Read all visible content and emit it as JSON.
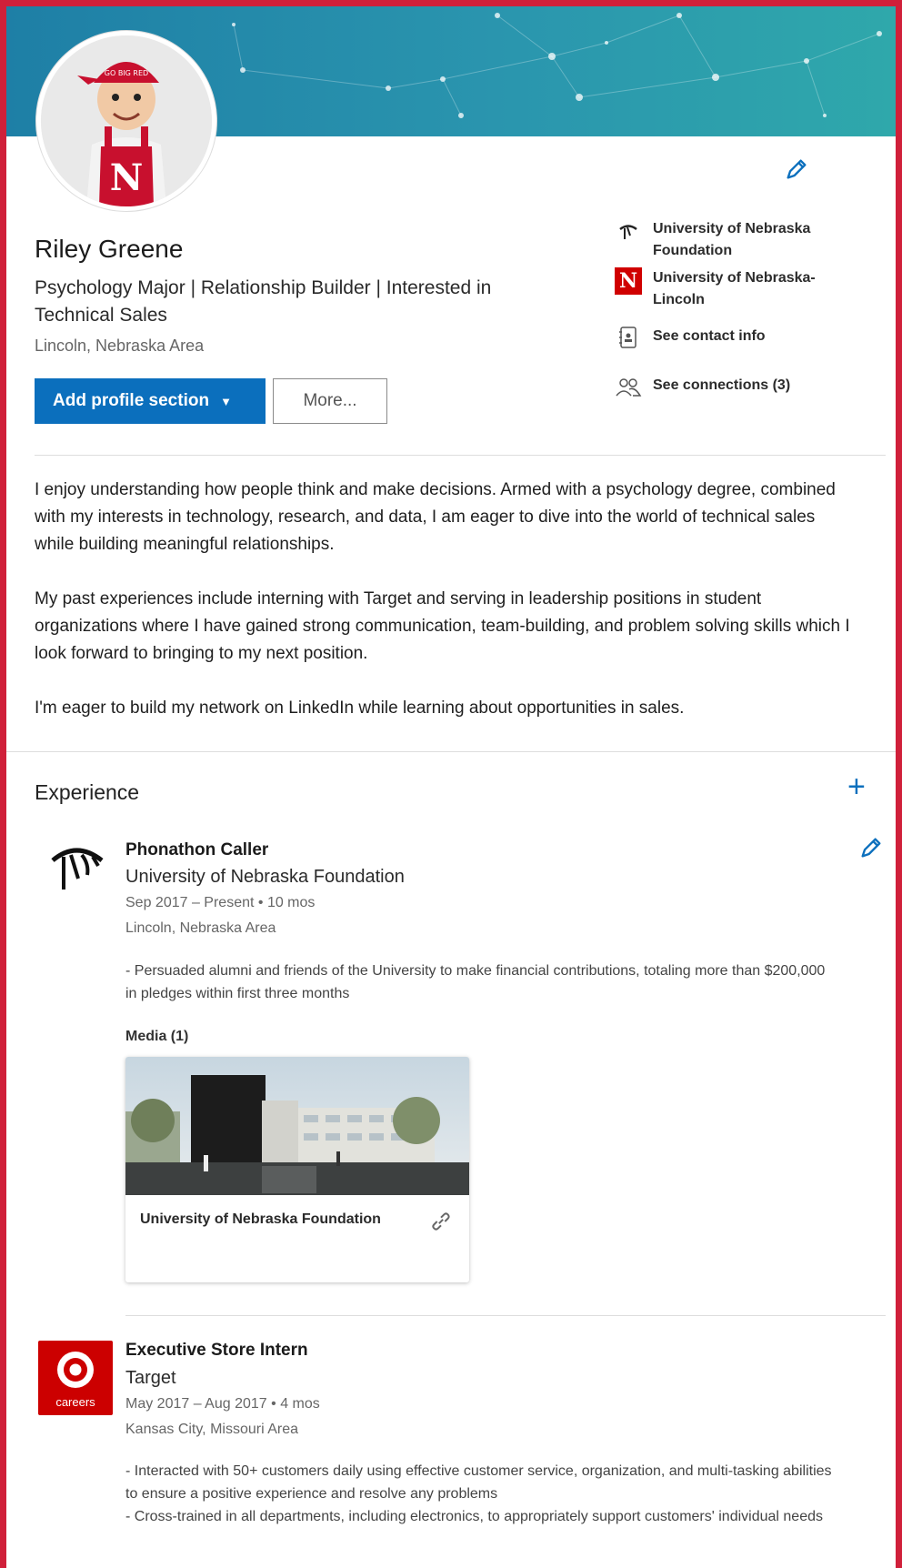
{
  "profile": {
    "name": "Riley Greene",
    "headline": "Psychology Major | Relationship Builder | Interested in Technical Sales",
    "location": "Lincoln, Nebraska Area"
  },
  "buttons": {
    "add_section": "Add profile section",
    "more": "More..."
  },
  "sidebar": {
    "items": [
      {
        "label": "University of Nebraska Foundation",
        "icon": "foundation-logo-icon"
      },
      {
        "label": "University of Nebraska-Lincoln",
        "icon": "nebraska-n-icon"
      },
      {
        "label": "See contact info",
        "icon": "contact-card-icon"
      },
      {
        "label": "See connections (3)",
        "icon": "people-icon"
      }
    ]
  },
  "summary": {
    "paragraphs": [
      "I enjoy understanding how people think and make decisions. Armed with a psychology degree, combined with my interests in technology, research, and data, I am eager to dive into the world of technical sales while building meaningful relationships.",
      "My past experiences include interning with Target and serving in leadership positions in student organizations where I have gained strong communication, team-building, and problem solving skills which I look forward to bringing to my next position.",
      "I'm eager to build my network on LinkedIn while learning about opportunities in sales."
    ]
  },
  "experience": {
    "title": "Experience",
    "jobs": [
      {
        "title": "Phonathon Caller",
        "company": "University of Nebraska Foundation",
        "dates": "Sep 2017 – Present",
        "duration": "10 mos",
        "location": "Lincoln, Nebraska Area",
        "description": [
          "- Persuaded alumni and friends of the University to make financial contributions, totaling more than $200,000 in pledges within first three months"
        ],
        "media_label": "Media (1)",
        "media_caption": "University of Nebraska Foundation"
      },
      {
        "title": "Executive Store Intern",
        "company": "Target",
        "dates": "May 2017 – Aug 2017",
        "duration": "4 mos",
        "location": "Kansas City, Missouri Area",
        "logo_text": "careers",
        "description": [
          "- Interacted with 50+ customers daily using effective customer service, organization, and multi-tasking abilities to ensure a positive experience and resolve any problems",
          "- Cross-trained in all departments, including electronics, to appropriately support customers' individual needs"
        ]
      }
    ]
  },
  "colors": {
    "accent": "#0b6fbd",
    "frame": "#d0203a",
    "nebraska_red": "#d00000",
    "target_red": "#cc0000"
  }
}
